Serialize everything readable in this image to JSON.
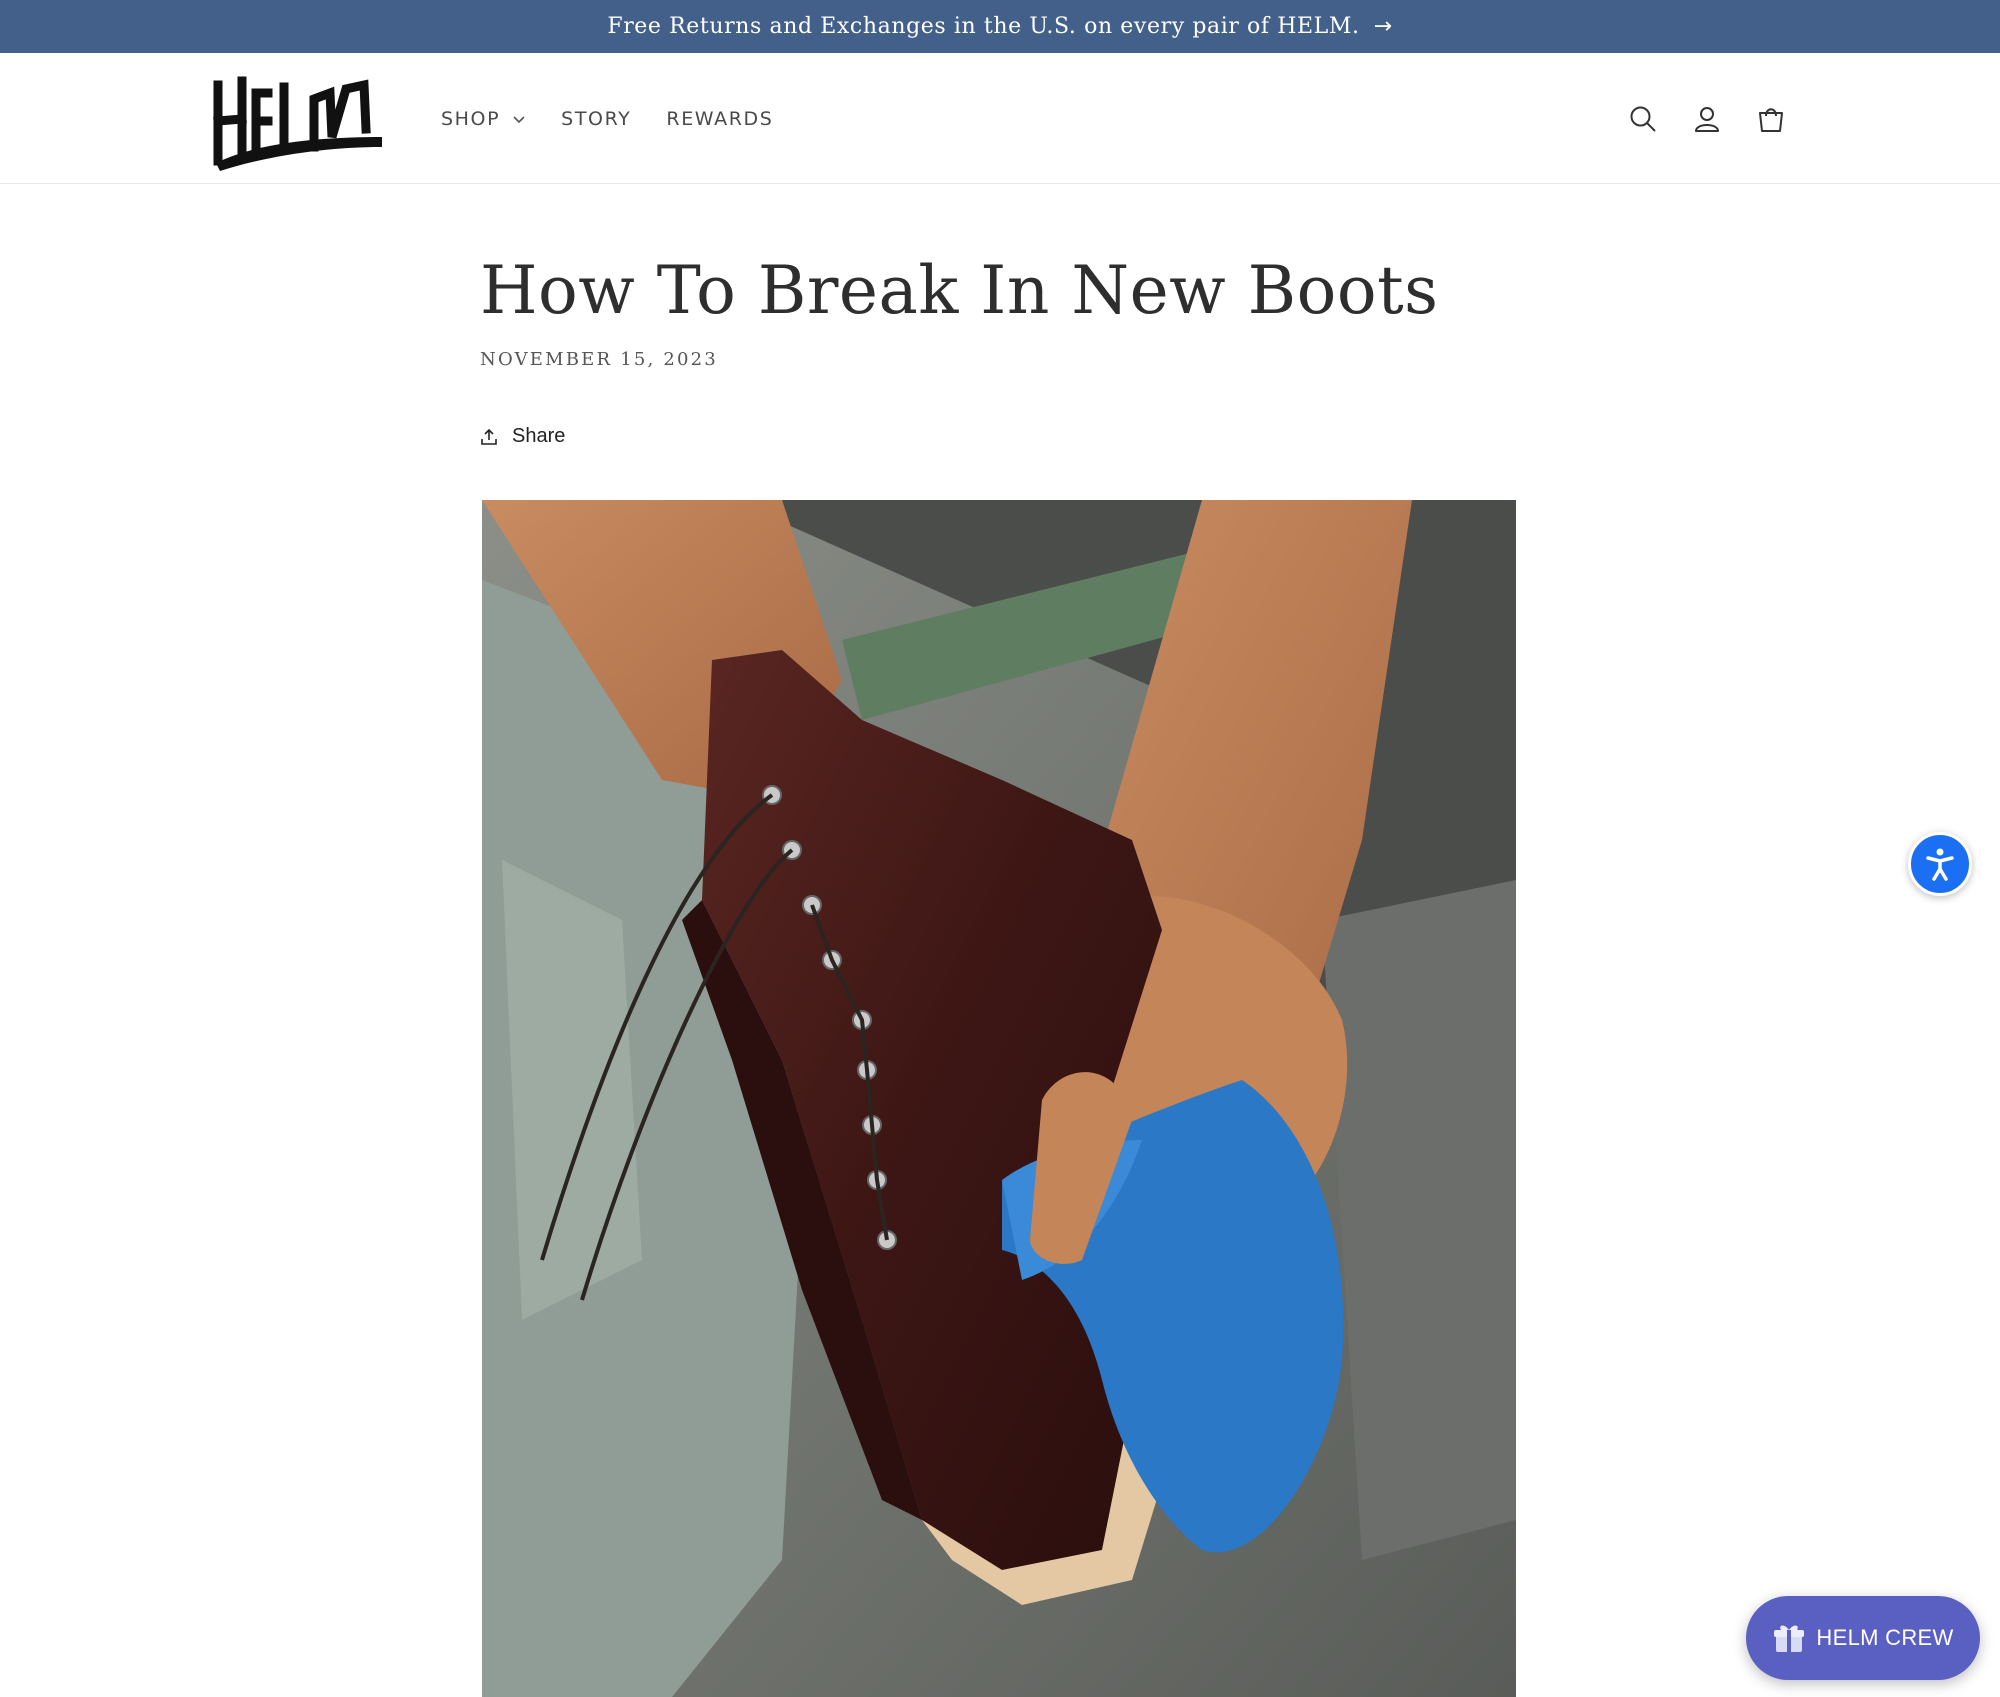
{
  "announcement": {
    "text": "Free Returns and Exchanges in the U.S. on every pair of HELM.",
    "arrow": "→"
  },
  "header": {
    "logo_text": "HELM",
    "nav": [
      {
        "label": "SHOP",
        "has_dropdown": true
      },
      {
        "label": "STORY",
        "has_dropdown": false
      },
      {
        "label": "REWARDS",
        "has_dropdown": false
      }
    ],
    "icons": [
      "search-icon",
      "account-icon",
      "cart-icon"
    ]
  },
  "article": {
    "title": "How To Break In New Boots",
    "date": "NOVEMBER 15, 2023",
    "share_label": "Share",
    "image_alt": "brown leather lace-up boot being wiped with a blue cloth"
  },
  "widgets": {
    "crew_label": "HELM CREW",
    "accessibility": "accessibility-icon"
  },
  "colors": {
    "announcement_bg": "#426089",
    "accessibility_bg": "#1a6ff2",
    "crew_bg": "#5a5fc2"
  }
}
